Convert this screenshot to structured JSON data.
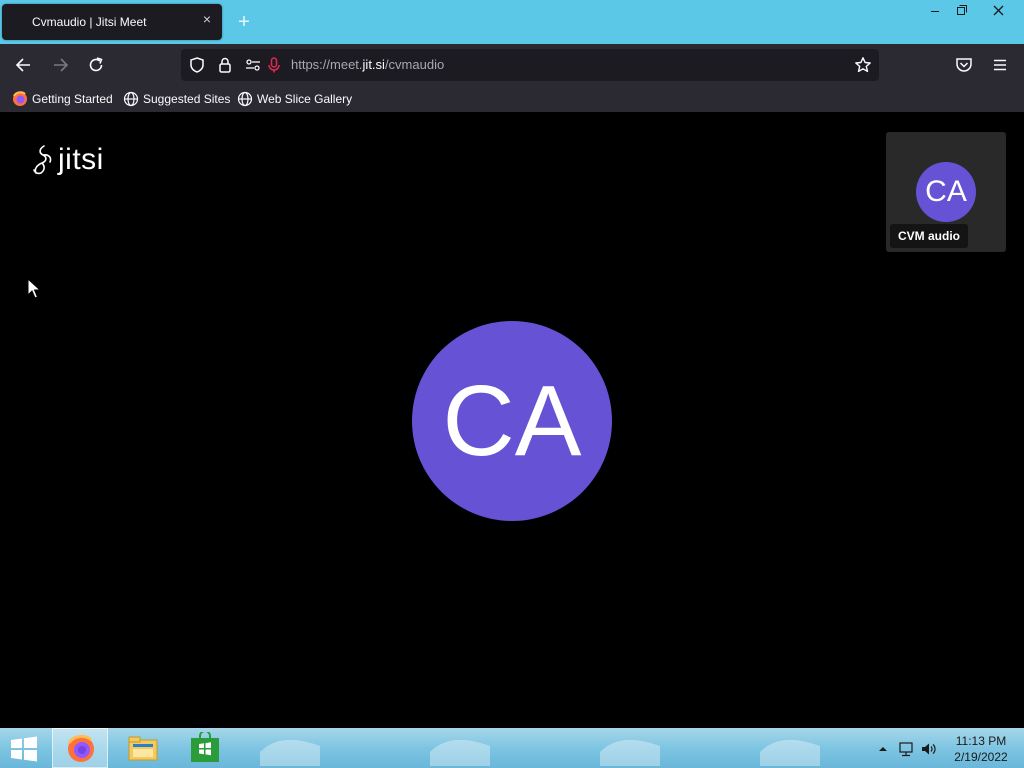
{
  "browser": {
    "tab_title": "Cvmaudio | Jitsi Meet",
    "url": {
      "prefix": "https://meet.",
      "domain": "jit.si",
      "path": "/cvmaudio"
    },
    "bookmarks": [
      {
        "label": "Getting Started",
        "icon": "firefox-icon"
      },
      {
        "label": "Suggested Sites",
        "icon": "globe-icon"
      },
      {
        "label": "Web Slice Gallery",
        "icon": "globe-icon"
      }
    ]
  },
  "meeting": {
    "logo_text": "jitsi",
    "main_avatar_initials": "CA",
    "thumbnail": {
      "initials": "CA",
      "display_name": "CVM audio"
    },
    "avatar_color": "#6652d4"
  },
  "taskbar": {
    "time": "11:13 PM",
    "date": "2/19/2022",
    "apps": [
      "firefox-icon",
      "file-explorer-icon",
      "store-icon"
    ]
  }
}
